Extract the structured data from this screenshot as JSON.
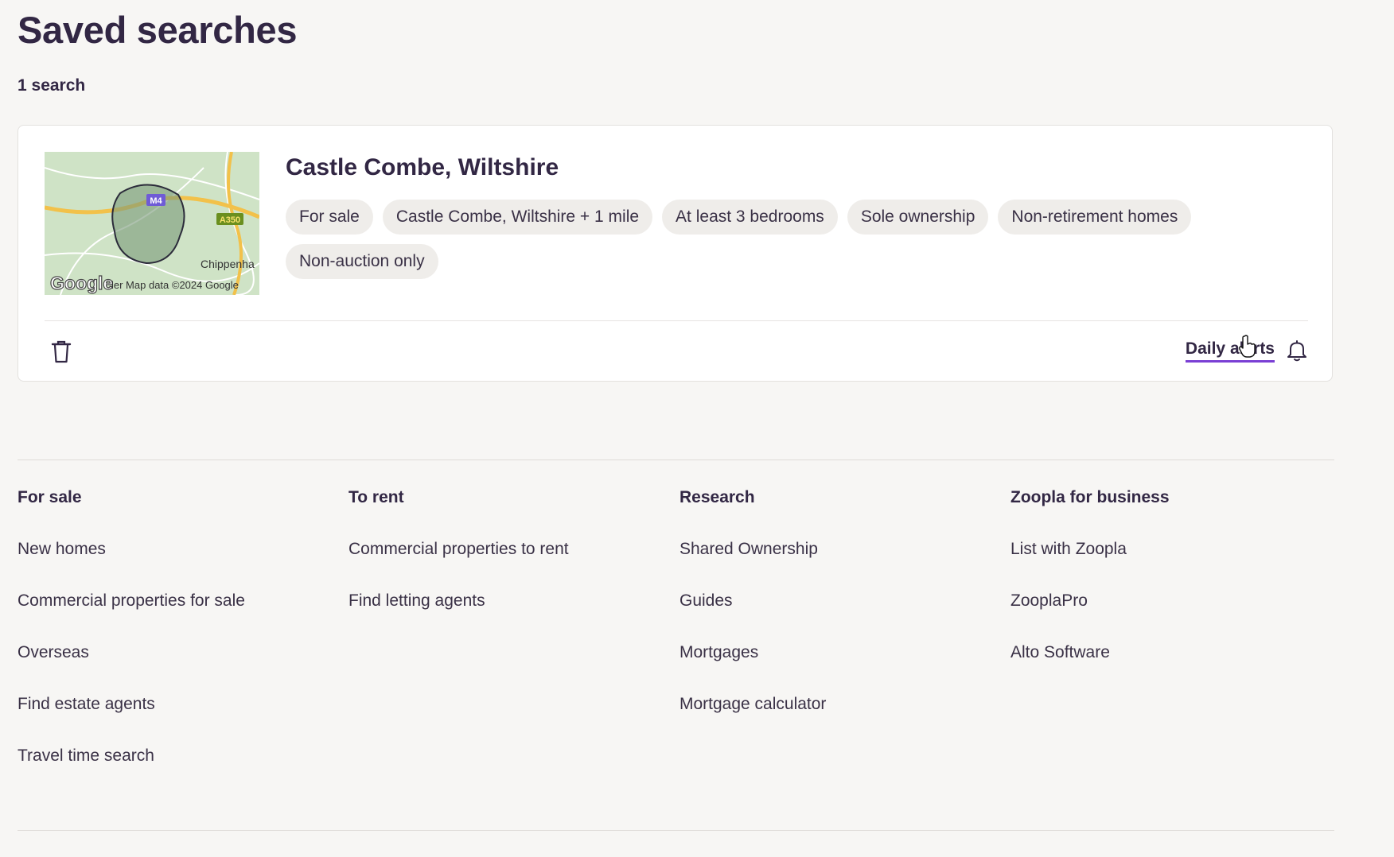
{
  "page": {
    "title": "Saved searches",
    "count": "1 search"
  },
  "saved_search": {
    "title": "Castle Combe, Wiltshire",
    "filters": [
      "For sale",
      "Castle Combe, Wiltshire + 1 mile",
      "At least 3 bedrooms",
      "Sole ownership",
      "Non-retirement homes",
      "Non-auction only"
    ],
    "map": {
      "road_labels": [
        "M4",
        "A350"
      ],
      "town_label": "Chippenha",
      "logo": "Google",
      "attribution": "ler Map data ©2024 Google"
    },
    "delete_icon": "trash-icon",
    "alerts_label": "Daily alerts",
    "alerts_icon": "bell-icon"
  },
  "footer": {
    "columns": [
      {
        "heading": "For sale",
        "links": [
          "New homes",
          "Commercial properties for sale",
          "Overseas",
          "Find estate agents",
          "Travel time search"
        ]
      },
      {
        "heading": "To rent",
        "links": [
          "Commercial properties to rent",
          "Find letting agents"
        ]
      },
      {
        "heading": "Research",
        "links": [
          "Shared Ownership",
          "Guides",
          "Mortgages",
          "Mortgage calculator"
        ]
      },
      {
        "heading": "Zoopla for business",
        "links": [
          "List with Zoopla",
          "ZooplaPro",
          "Alto Software"
        ]
      }
    ]
  },
  "colors": {
    "background": "#f7f6f4",
    "text": "#322744",
    "accent": "#7a3fd4",
    "chip": "#efedea"
  }
}
